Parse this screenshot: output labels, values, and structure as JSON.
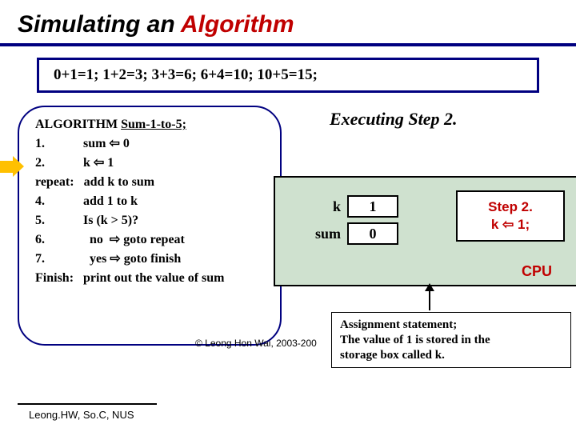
{
  "title": {
    "pre": "Simulating an ",
    "red": "Algorithm"
  },
  "trace": "0+1=1;  1+2=3;  3+3=6;  6+4=10;  10+5=15;",
  "algo": {
    "header_a": "ALGORITHM ",
    "header_b": "Sum-1-to-5;",
    "l1": "1.            sum ⇦ 0",
    "l2": "2.            k ⇦ 1",
    "l3": "repeat:   add k to sum",
    "l4": "4.            add 1 to k",
    "l5": "5.            Is (k > 5)?",
    "l6": "6.              no  ⇨ goto repeat",
    "l7": "7.              yes ⇨ goto finish",
    "l8": "Finish:   print out the value of sum"
  },
  "exec_label": "Executing Step 2.",
  "vars": {
    "k_label": "k",
    "k_value": "1",
    "sum_label": "sum",
    "sum_value": "0"
  },
  "step_box": {
    "line1": "Step 2.",
    "line2": "k ⇦ 1;"
  },
  "cpu_label": "CPU",
  "assign": {
    "l1": "Assignment statement;",
    "l2": "The value of 1 is stored in the",
    "l3": "storage box called k."
  },
  "copyright": "© Leong Hon Wai, 2003-200",
  "footer": "Leong.HW, So.C, NUS"
}
